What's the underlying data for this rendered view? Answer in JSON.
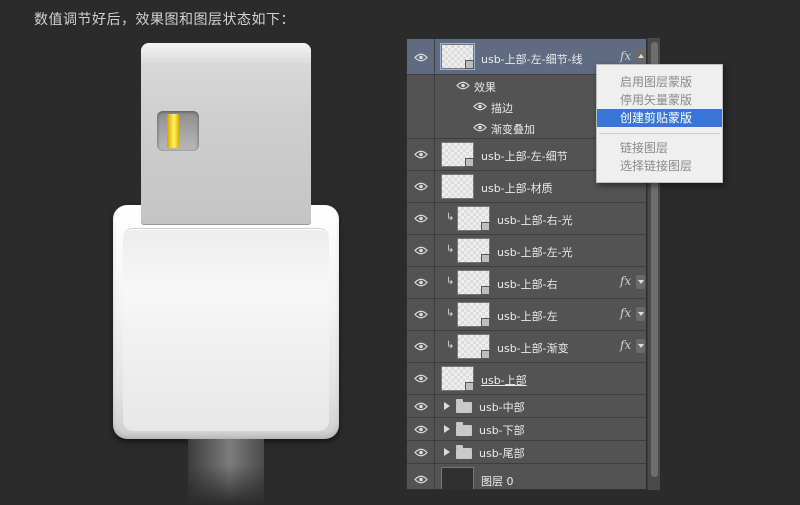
{
  "caption": "数值调节好后，效果图和图层状态如下：",
  "layers": [
    {
      "name": "usb-上部-左-细节-线",
      "fx": "fx",
      "selected": true
    },
    {
      "name": "usb-上部-左-细节"
    },
    {
      "name": "usb-上部-材质"
    },
    {
      "name": "usb-上部-右-光"
    },
    {
      "name": "usb-上部-左-光"
    },
    {
      "name": "usb-上部-右",
      "fx": "fx"
    },
    {
      "name": "usb-上部-左",
      "fx": "fx"
    },
    {
      "name": "usb-上部-渐变",
      "fx": "fx"
    },
    {
      "name": "usb-上部"
    },
    {
      "name": "usb-中部"
    },
    {
      "name": "usb-下部"
    },
    {
      "name": "usb-尾部"
    },
    {
      "name": "图层 0"
    }
  ],
  "effects": {
    "header": "效果",
    "items": [
      "描边",
      "渐变叠加"
    ]
  },
  "context_menu": {
    "items": [
      "启用图层蒙版",
      "停用矢量蒙版",
      "创建剪贴蒙版",
      "链接图层",
      "选择链接图层"
    ],
    "active": "创建剪贴蒙版"
  },
  "colors": {
    "panel_bg": "#535353",
    "selected_row": "#5e6b80",
    "menu_highlight": "#3875d7",
    "usb_pin": "#ffe23a"
  }
}
